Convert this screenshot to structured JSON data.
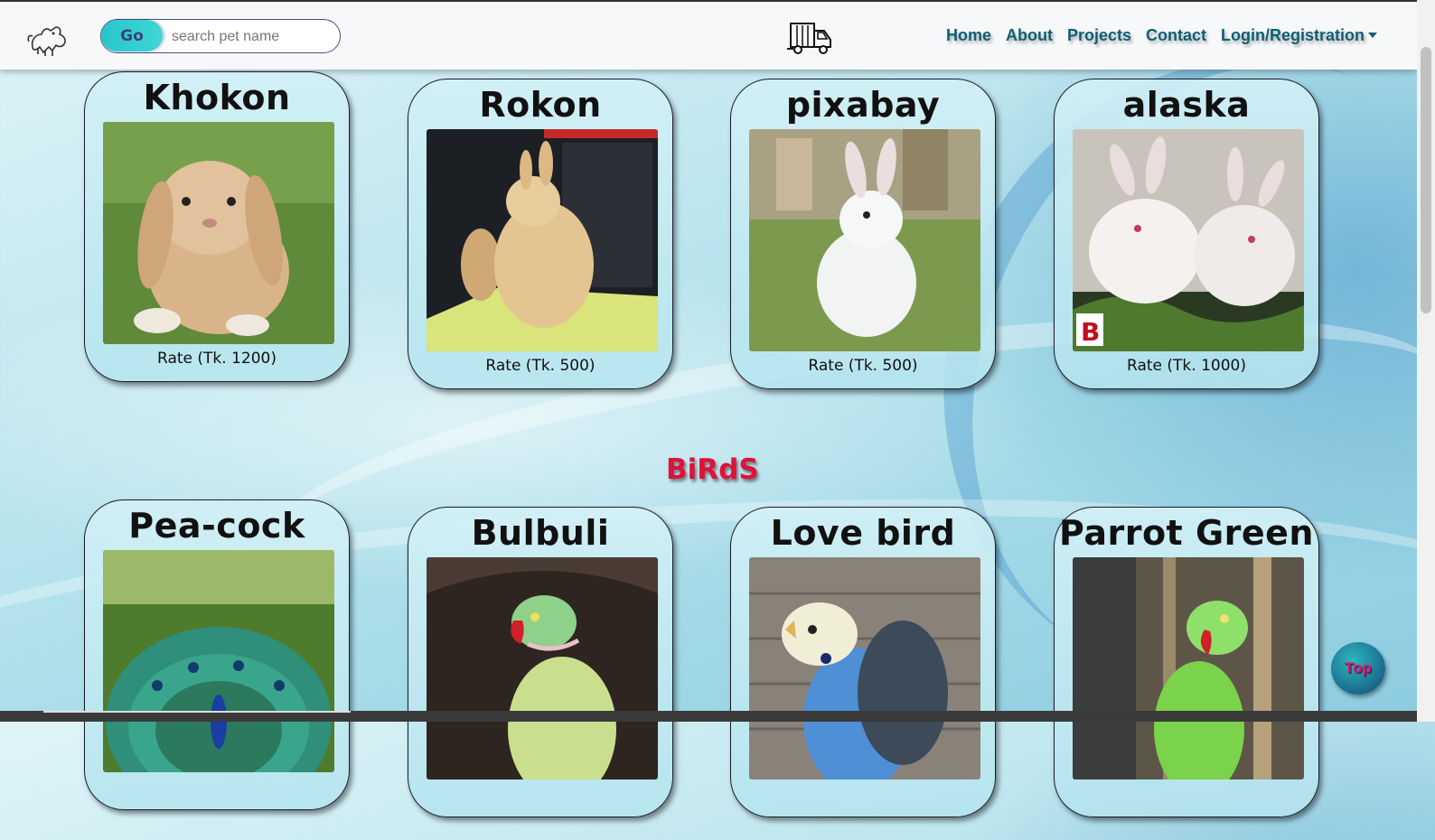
{
  "search": {
    "button_label": "Go",
    "placeholder": "search pet name"
  },
  "nav": {
    "logo_icon": "dog-icon",
    "center_icon": "truck-icon",
    "links": [
      {
        "label": "Home"
      },
      {
        "label": "About"
      },
      {
        "label": "Projects"
      },
      {
        "label": "Contact"
      },
      {
        "label": "Login/Registration",
        "dropdown": true
      }
    ],
    "link_color": "#0d5f74"
  },
  "rabbits": [
    {
      "name": "Khokon",
      "rate": "Rate (Tk. 1200)",
      "image": "lop-eared rabbit on grass"
    },
    {
      "name": "Rokon",
      "rate": "Rate (Tk. 500)",
      "image": "fluffy rabbit near car"
    },
    {
      "name": "pixabay",
      "rate": "Rate (Tk. 500)",
      "image": "white rabbit in grass"
    },
    {
      "name": "alaska",
      "rate": "Rate (Tk. 1000)",
      "image": "two white rabbits",
      "badge": "B"
    }
  ],
  "birds_section": {
    "title": "BiRdS",
    "color": "#e0113a"
  },
  "birds": [
    {
      "name": "Pea-cock",
      "image": "peacock with open tail"
    },
    {
      "name": "Bulbuli",
      "image": "green parakeet"
    },
    {
      "name": "Love bird",
      "image": "blue budgie"
    },
    {
      "name": "Parrot Green",
      "image": "green parrot"
    }
  ],
  "top_button": {
    "label": "Top"
  }
}
